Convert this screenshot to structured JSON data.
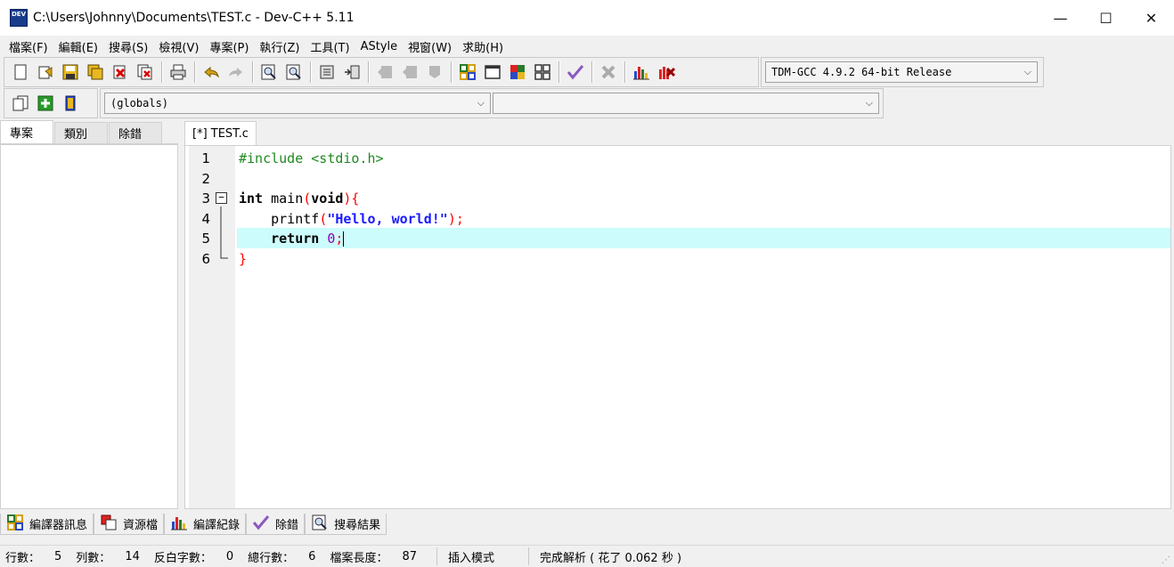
{
  "window": {
    "title": "C:\\Users\\Johnny\\Documents\\TEST.c - Dev-C++ 5.11",
    "icon_label": "DEV",
    "minimize": "—",
    "maximize": "☐",
    "close": "✕"
  },
  "menu": [
    "檔案(F)",
    "編輯(E)",
    "搜尋(S)",
    "檢視(V)",
    "專案(P)",
    "執行(Z)",
    "工具(T)",
    "AStyle",
    "視窗(W)",
    "求助(H)"
  ],
  "toolbar": {
    "compiler": "TDM-GCC 4.9.2 64-bit Release",
    "scope": "(globals)",
    "function": ""
  },
  "left_panel": {
    "tabs": [
      "專案",
      "類別",
      "除錯"
    ]
  },
  "editor": {
    "tab_label": "[*] TEST.c",
    "line_numbers": [
      "1",
      "2",
      "3",
      "4",
      "5",
      "6"
    ],
    "lines": {
      "l1": "#include <stdio.h>",
      "l3_kw": "int",
      "l3_name": " main",
      "l3_open": "(",
      "l3_void": "void",
      "l3_close": "){",
      "l4_indent": "    printf",
      "l4_open": "(",
      "l4_str": "\"Hello, world!\"",
      "l4_close": ");",
      "l5_indent": "    ",
      "l5_kw": "return",
      "l5_num": " 0",
      "l5_semi": ";",
      "l6": "}"
    },
    "current_line": 5
  },
  "bottom_tabs": [
    {
      "label": "編譯器訊息",
      "icon": "grid-icon"
    },
    {
      "label": "資源檔",
      "icon": "resource-icon"
    },
    {
      "label": "編譯紀錄",
      "icon": "chart-icon"
    },
    {
      "label": "除錯",
      "icon": "check-icon"
    },
    {
      "label": "搜尋結果",
      "icon": "search-icon"
    }
  ],
  "status": {
    "line_label": "行數：",
    "line_value": "5",
    "col_label": "列數：",
    "col_value": "14",
    "sel_label": "反白字數：",
    "sel_value": "0",
    "total_label": "總行數：",
    "total_value": "6",
    "length_label": "檔案長度：",
    "length_value": "87",
    "mode": "插入模式",
    "parse": "完成解析 ( 花了 0.062 秒 )"
  },
  "colors": {
    "current_line_highlight": "#ccfcfc",
    "preprocessor": "#1e8a1e",
    "string": "#1a1aff",
    "number": "#8b00b8",
    "symbol": "#ff0000"
  }
}
